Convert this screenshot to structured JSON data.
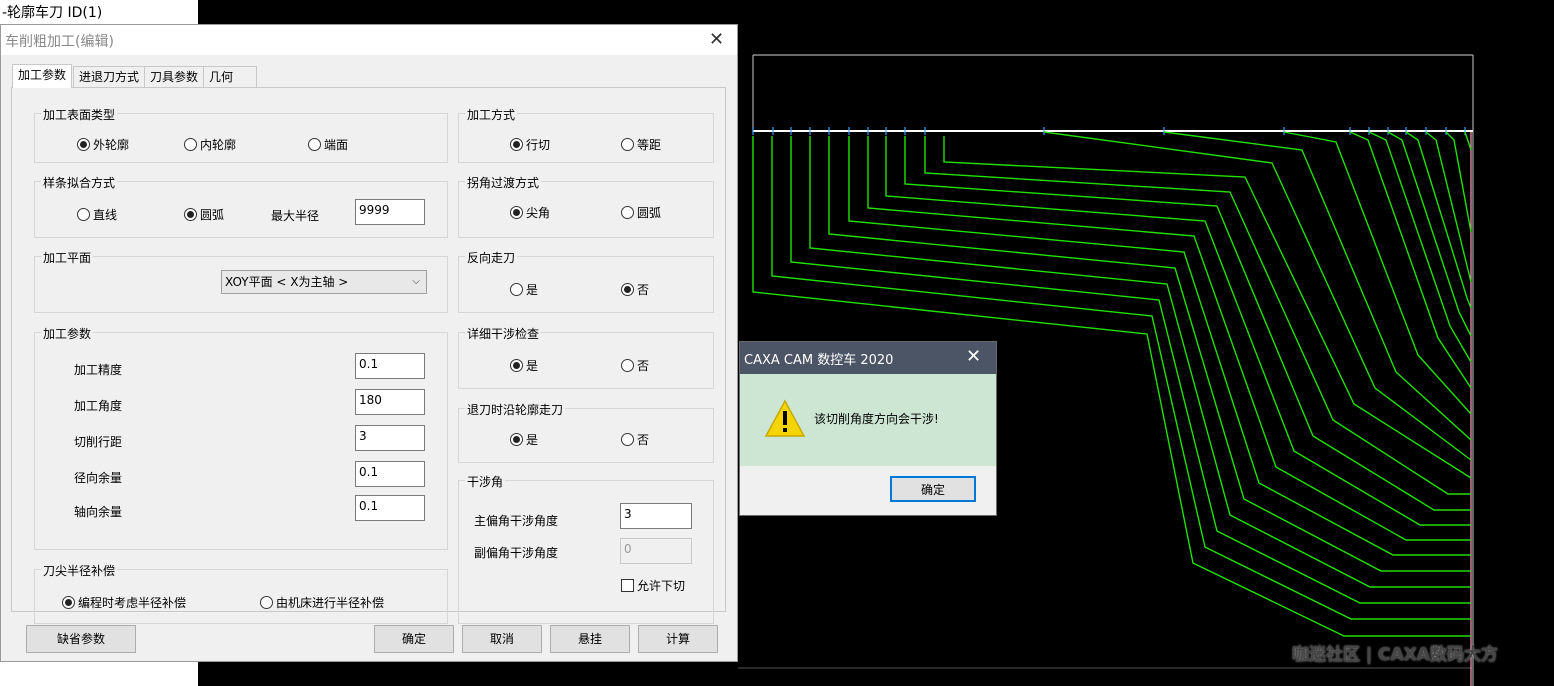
{
  "background_window": {
    "title": "-轮廓车刀 ID(1)"
  },
  "dialog": {
    "title": "车削粗加工(编辑)",
    "tabs": [
      "加工参数",
      "进退刀方式",
      "刀具参数",
      "几何"
    ],
    "surface_type": {
      "label": "加工表面类型",
      "options": [
        "外轮廓",
        "内轮廓",
        "端面"
      ]
    },
    "spline_fit": {
      "label": "样条拟合方式",
      "options": [
        "直线",
        "圆弧"
      ],
      "max_radius_label": "最大半径",
      "max_radius_value": "9999"
    },
    "plane": {
      "label": "加工平面",
      "value": "XOY平面 < X为主轴 >"
    },
    "params": {
      "label": "加工参数",
      "precision_label": "加工精度",
      "precision_value": "0.1",
      "angle_label": "加工角度",
      "angle_value": "180",
      "stepover_label": "切削行距",
      "stepover_value": "3",
      "radial_label": "径向余量",
      "radial_value": "0.1",
      "axial_label": "轴向余量",
      "axial_value": "0.1"
    },
    "nose_comp": {
      "label": "刀尖半径补偿",
      "options": [
        "编程时考虑半径补偿",
        "由机床进行半径补偿"
      ]
    },
    "method": {
      "label": "加工方式",
      "options": [
        "行切",
        "等距"
      ]
    },
    "corner": {
      "label": "拐角过渡方式",
      "options": [
        "尖角",
        "圆弧"
      ]
    },
    "reverse": {
      "label": "反向走刀",
      "options": [
        "是",
        "否"
      ]
    },
    "interference_check": {
      "label": "详细干涉检查",
      "options": [
        "是",
        "否"
      ]
    },
    "retract_contour": {
      "label": "退刀时沿轮廓走刀",
      "options": [
        "是",
        "否"
      ]
    },
    "interference_angle": {
      "label": "干涉角",
      "main_label": "主偏角干涉角度",
      "main_value": "3",
      "sub_label": "副偏角干涉角度",
      "sub_value": "0",
      "allow_undercut": "允许下切"
    },
    "buttons": {
      "default": "缺省参数",
      "ok": "确定",
      "cancel": "取消",
      "suspend": "悬挂",
      "calc": "计算"
    }
  },
  "message_box": {
    "title": "CAXA CAM 数控车 2020",
    "text": "该切削角度方向会干涉!",
    "ok": "确定",
    "icon": "warning-icon"
  },
  "watermark": "咖迷社区 | CAXA数码大方",
  "colors": {
    "toolpath": "#22e000",
    "boundary": "#ffffff",
    "pink": "#ff9ec0"
  }
}
